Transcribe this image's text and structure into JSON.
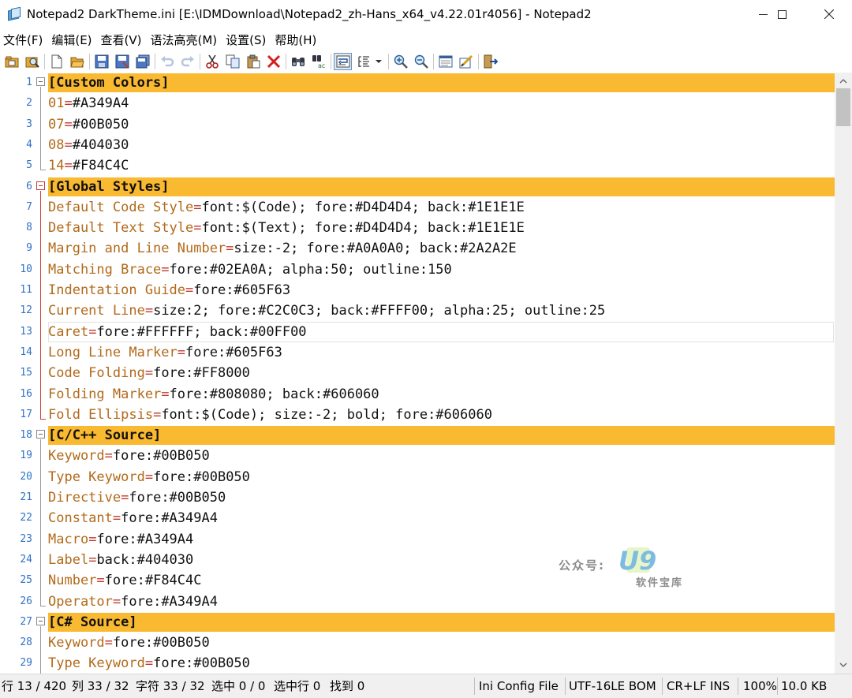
{
  "window": {
    "title": "Notepad2 DarkTheme.ini [E:\\IDMDownload\\Notepad2_zh-Hans_x64_v4.22.01r4056] - Notepad2",
    "controls": {
      "minimize": "minimize",
      "maximize": "maximize",
      "close": "close"
    }
  },
  "menu": [
    "文件(F)",
    "编辑(E)",
    "查看(V)",
    "语法高亮(M)",
    "设置(S)",
    "帮助(H)"
  ],
  "toolbar": [
    "open-folder-icon",
    "browse-icon",
    "new-file-icon",
    "open-file-icon",
    "save-icon",
    "save-as-icon",
    "save-copy-icon",
    "undo-icon",
    "redo-icon",
    "cut-icon",
    "copy-icon",
    "paste-icon",
    "delete-icon",
    "find-icon",
    "replace-icon",
    "word-wrap-icon",
    "indent-guides-icon",
    "zoom-in-icon",
    "zoom-out-icon",
    "scheme-icon",
    "customize-scheme-icon",
    "exit-icon"
  ],
  "editor": {
    "current_line": 13,
    "lines": [
      {
        "n": "1",
        "type": "section",
        "text": "[Custom Colors]",
        "fold": "open"
      },
      {
        "n": "2",
        "type": "kv",
        "key": "01",
        "value": "#A349A4",
        "fold": "mid"
      },
      {
        "n": "3",
        "type": "kv",
        "key": "07",
        "value": "#00B050",
        "fold": "mid"
      },
      {
        "n": "4",
        "type": "kv",
        "key": "08",
        "value": "#404030",
        "fold": "mid"
      },
      {
        "n": "5",
        "type": "kv",
        "key": "14",
        "value": "#F84C4C",
        "fold": "end"
      },
      {
        "n": "6",
        "type": "section",
        "text": "[Global Styles]",
        "fold": "open-red"
      },
      {
        "n": "7",
        "type": "kv",
        "key": "Default Code Style",
        "value": "font:$(Code); fore:#D4D4D4; back:#1E1E1E",
        "fold": "mid-red"
      },
      {
        "n": "8",
        "type": "kv",
        "key": "Default Text Style",
        "value": "font:$(Text); fore:#D4D4D4; back:#1E1E1E",
        "fold": "mid-red"
      },
      {
        "n": "9",
        "type": "kv",
        "key": "Margin and Line Number",
        "value": "size:-2; fore:#A0A0A0; back:#2A2A2E",
        "fold": "mid-red"
      },
      {
        "n": "10",
        "type": "kv",
        "key": "Matching Brace",
        "value": "fore:#02EA0A; alpha:50; outline:150",
        "fold": "mid-red"
      },
      {
        "n": "11",
        "type": "kv",
        "key": "Indentation Guide",
        "value": "fore:#605F63",
        "fold": "mid-red"
      },
      {
        "n": "12",
        "type": "kv",
        "key": "Current Line",
        "value": "size:2; fore:#C2C0C3; back:#FFFF00; alpha:25; outline:25",
        "fold": "mid-red"
      },
      {
        "n": "13",
        "type": "kv",
        "key": "Caret",
        "value": "fore:#FFFFFF; back:#00FF00",
        "fold": "mid-red"
      },
      {
        "n": "14",
        "type": "kv",
        "key": "Long Line Marker",
        "value": "fore:#605F63",
        "fold": "mid-red"
      },
      {
        "n": "15",
        "type": "kv",
        "key": "Code Folding",
        "value": "fore:#FF8000",
        "fold": "mid-red"
      },
      {
        "n": "16",
        "type": "kv",
        "key": "Folding Marker",
        "value": "fore:#808080; back:#606060",
        "fold": "mid-red"
      },
      {
        "n": "17",
        "type": "kv",
        "key": "Fold Ellipsis",
        "value": "font:$(Code); size:-2; bold; fore:#606060",
        "fold": "end-red"
      },
      {
        "n": "18",
        "type": "section",
        "text": "[C/C++ Source]",
        "fold": "open"
      },
      {
        "n": "19",
        "type": "kv",
        "key": "Keyword",
        "value": "fore:#00B050",
        "fold": "mid"
      },
      {
        "n": "20",
        "type": "kv",
        "key": "Type Keyword",
        "value": "fore:#00B050",
        "fold": "mid"
      },
      {
        "n": "21",
        "type": "kv",
        "key": "Directive",
        "value": "fore:#00B050",
        "fold": "mid"
      },
      {
        "n": "22",
        "type": "kv",
        "key": "Constant",
        "value": "fore:#A349A4",
        "fold": "mid"
      },
      {
        "n": "23",
        "type": "kv",
        "key": "Macro",
        "value": "fore:#A349A4",
        "fold": "mid"
      },
      {
        "n": "24",
        "type": "kv",
        "key": "Label",
        "value": "back:#404030",
        "fold": "mid"
      },
      {
        "n": "25",
        "type": "kv",
        "key": "Number",
        "value": "fore:#F84C4C",
        "fold": "mid"
      },
      {
        "n": "26",
        "type": "kv",
        "key": "Operator",
        "value": "fore:#A349A4",
        "fold": "end"
      },
      {
        "n": "27",
        "type": "section",
        "text": "[C# Source]",
        "fold": "open"
      },
      {
        "n": "28",
        "type": "kv",
        "key": "Keyword",
        "value": "fore:#00B050",
        "fold": "mid"
      },
      {
        "n": "29",
        "type": "kv",
        "key": "Type Keyword",
        "value": "fore:#00B050",
        "fold": "mid"
      }
    ]
  },
  "watermark": {
    "prefix": "公众号:",
    "logo": "U9",
    "sub": "软件宝库"
  },
  "status": {
    "line": "行 13 / 420",
    "col": "列 33 / 32",
    "char": "字符 33 / 32",
    "sel": "选中 0 / 0",
    "sel_lines": "选中行 0",
    "found": "找到 0",
    "lexer": "Ini Config File",
    "encoding": "UTF-16LE BOM",
    "eol": "CR+LF",
    "ovr": "INS",
    "zoom": "100%",
    "size": "10.0 KB"
  },
  "colors": {
    "section_bg": "#F9B930",
    "key": "#B26A1A",
    "eq": "#C0392B",
    "line_number": "#2F72C6",
    "fold_red": "#D23C3C"
  }
}
